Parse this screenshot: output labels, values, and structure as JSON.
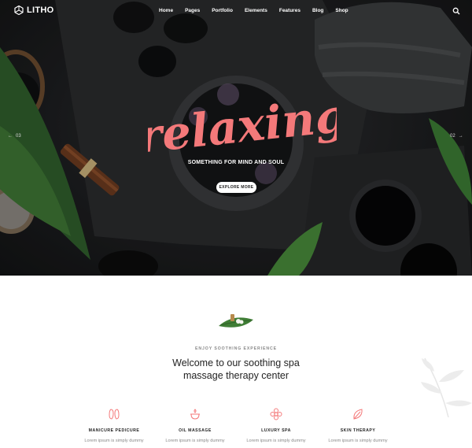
{
  "brand": {
    "name": "LITHO"
  },
  "nav": {
    "items": [
      "Home",
      "Pages",
      "Portfolio",
      "Elements",
      "Features",
      "Blog",
      "Shop"
    ],
    "search_icon": "search-icon"
  },
  "hero": {
    "headline": "relaxing",
    "subtitle": "SOMETHING FOR MIND AND SOUL",
    "cta": "EXPLORE MORE",
    "slide_prev": "03",
    "slide_next": "02"
  },
  "welcome": {
    "eyebrow": "ENJOY SOOTHING EXPERIENCE",
    "title_line1": "Welcome to our soothing spa",
    "title_line2": "massage therapy center"
  },
  "services": [
    {
      "name": "MANICURE PEDICURE",
      "desc": "Lorem ipsum is simply dummy",
      "icon": "feet-icon"
    },
    {
      "name": "OIL MASSAGE",
      "desc": "Lorem ipsum is simply dummy",
      "icon": "oil-lamp-icon"
    },
    {
      "name": "LUXURY SPA",
      "desc": "Lorem ipsum is simply dummy",
      "icon": "flower-icon"
    },
    {
      "name": "SKIN THERAPY",
      "desc": "Lorem ipsum is simply dummy",
      "icon": "leaf-icon"
    }
  ],
  "colors": {
    "accent": "#f4797a",
    "dark": "#1d1e20",
    "text": "#232323",
    "muted": "#888888"
  }
}
